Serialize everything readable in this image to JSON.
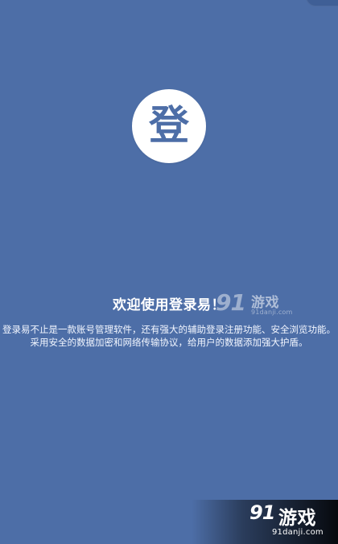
{
  "logo": {
    "glyph": "登"
  },
  "welcome": {
    "title": "欢迎使用登录易！"
  },
  "description": {
    "text": "登录易不止是一款账号管理软件，还有强大的辅助登录注册功能、安全浏览功能。 采用安全的数据加密和网络传输协议，给用户的数据添加强大护盾。"
  },
  "watermarks": {
    "mid": {
      "brand_mark": "91",
      "brand_title": "游戏",
      "site": "91danji.com"
    },
    "bottom": {
      "brand_mark": "91",
      "brand_title": "游戏",
      "site": "91danji.com"
    }
  },
  "colors": {
    "background": "#4d6ea7",
    "logo_background": "#ffffff",
    "logo_glyph": "#4d6ea7",
    "text": "#ffffff"
  }
}
